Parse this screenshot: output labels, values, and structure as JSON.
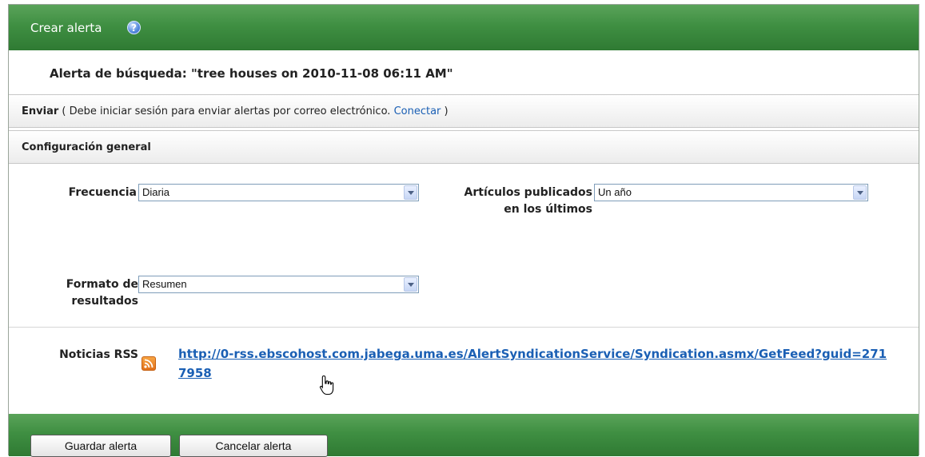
{
  "header": {
    "title": "Crear alerta",
    "help_icon": "question-mark-icon"
  },
  "search_alert": {
    "title": "Alerta de búsqueda: \"tree houses on 2010-11-08 06:11 AM\""
  },
  "send": {
    "label": "Enviar",
    "message_open": "( Debe iniciar sesión para enviar alertas por correo electrónico.",
    "connect_link": "Conectar",
    "message_close": ")"
  },
  "config": {
    "heading": "Configuración general"
  },
  "fields": {
    "frequency": {
      "label": "Frecuencia",
      "value": "Diaria"
    },
    "published": {
      "label": "Artículos publicados en los últimos",
      "value": "Un año"
    },
    "format": {
      "label": "Formato de resultados",
      "value": "Resumen"
    }
  },
  "rss": {
    "label": "Noticias RSS",
    "icon": "rss-feed-icon",
    "url": "http://0-rss.ebscohost.com.jabega.uma.es/AlertSyndicationService/Syndication.asmx/GetFeed?guid=2717958"
  },
  "footer": {
    "save_label": "Guardar alerta",
    "cancel_label": "Cancelar alerta"
  },
  "colors": {
    "header_green": "#3f8f42",
    "link_blue": "#1a5fb4",
    "rss_orange": "#e2711b"
  }
}
